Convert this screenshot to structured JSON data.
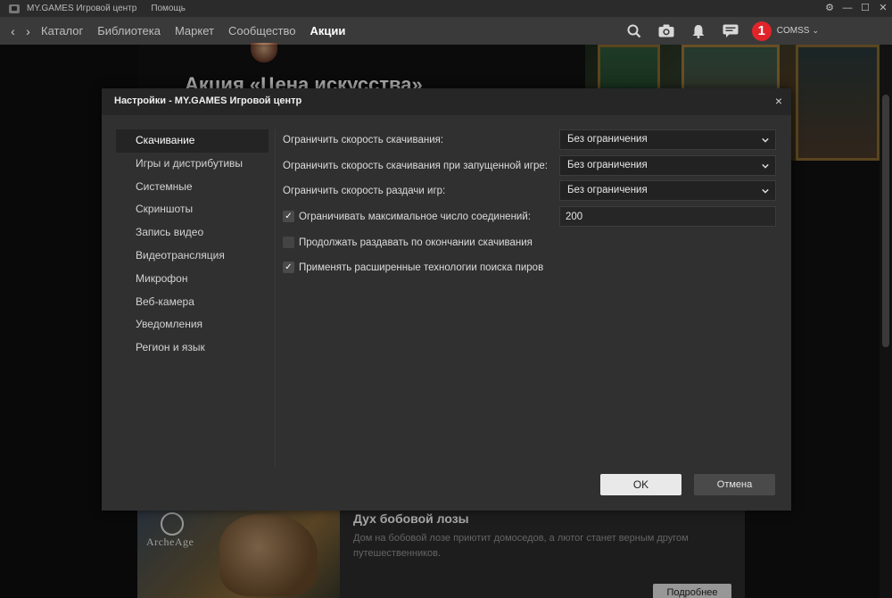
{
  "titlebar": {
    "app_name": "MY.GAMES Игровой центр",
    "help": "Помощь",
    "controls": [
      "⚙",
      "—",
      "☐",
      "✕"
    ]
  },
  "nav": {
    "back": "‹",
    "forward": "›",
    "links": [
      {
        "label": "Каталог",
        "active": false
      },
      {
        "label": "Библиотека",
        "active": false
      },
      {
        "label": "Маркет",
        "active": false
      },
      {
        "label": "Сообщество",
        "active": false
      },
      {
        "label": "Акции",
        "active": true
      }
    ],
    "icons": [
      "search-icon",
      "camera-icon",
      "notification-bell-icon",
      "chat-icon"
    ],
    "avatar_letter": "1",
    "username": "COMSS",
    "username_chevron": "⌄",
    "avatar_color": "#e0242a"
  },
  "background": {
    "promo_title": "Акция «Цена искусства»",
    "card": {
      "game_logo": "ArcheAge",
      "title": "Дух бобовой лозы",
      "description": "Дом на бобовой лозе приютит домоседов, а лютог станет верным другом путешественников.",
      "button": "Подробнее"
    }
  },
  "modal": {
    "title": "Настройки - MY.GAMES Игровой центр",
    "close": "×",
    "side_items": [
      {
        "label": "Скачивание",
        "active": true
      },
      {
        "label": "Игры и дистрибутивы",
        "active": false
      },
      {
        "label": "Системные",
        "active": false
      },
      {
        "label": "Скриншоты",
        "active": false
      },
      {
        "label": "Запись видео",
        "active": false
      },
      {
        "label": "Видеотрансляция",
        "active": false
      },
      {
        "label": "Микрофон",
        "active": false
      },
      {
        "label": "Веб-камера",
        "active": false
      },
      {
        "label": "Уведомления",
        "active": false
      },
      {
        "label": "Регион и язык",
        "active": false
      }
    ],
    "settings": {
      "download_speed": {
        "label": "Ограничить скорость скачивания:",
        "value": "Без ограничения"
      },
      "download_speed_ingame": {
        "label": "Ограничить скорость скачивания при запущенной игре:",
        "value": "Без ограничения"
      },
      "upload_speed": {
        "label": "Ограничить скорость раздачи игр:",
        "value": "Без ограничения"
      },
      "max_connections": {
        "label": "Ограничивать максимальное число соединений:",
        "checked": true,
        "value": "200"
      },
      "continue_seeding": {
        "label": "Продолжать раздавать по окончании скачивания",
        "checked": false
      },
      "peer_search": {
        "label": "Применять расширенные технологии поиска пиров",
        "checked": true
      }
    },
    "ok": "OK",
    "cancel": "Отмена",
    "check_mark": "✓"
  }
}
